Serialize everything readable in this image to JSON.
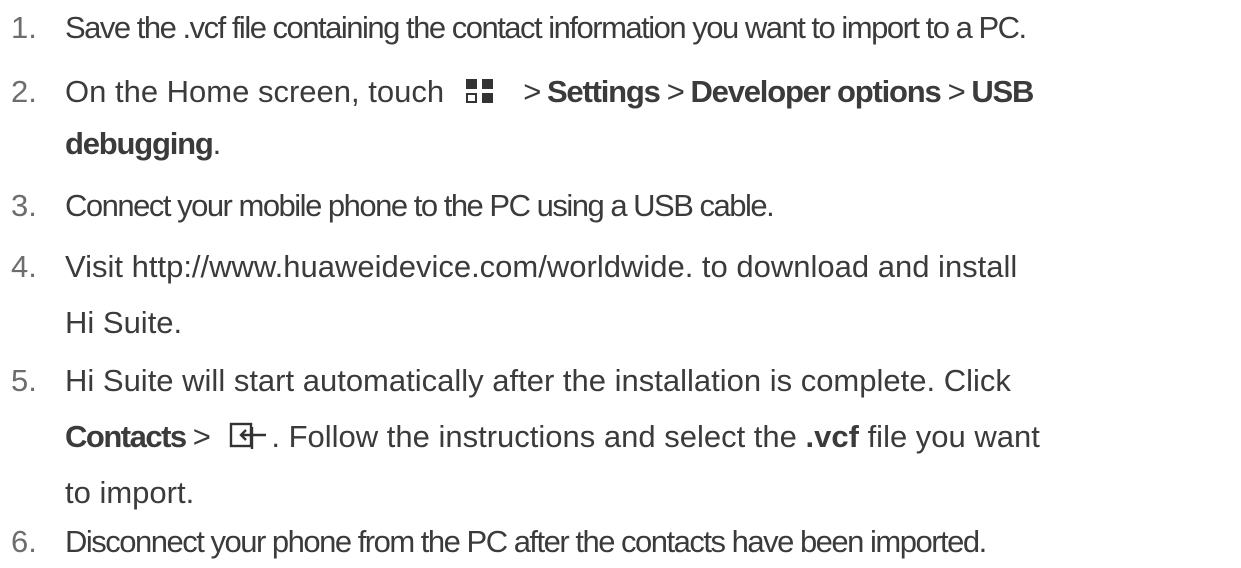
{
  "steps": [
    {
      "number": "1.",
      "text": "Save the .vcf file containing the contact information you want to import to a PC."
    },
    {
      "number": "2.",
      "prefix": "On the Home screen, touch",
      "sep1": " > ",
      "settings": "Settings",
      "sep2": " > ",
      "developer_options": "Developer options",
      "sep3": " > ",
      "usb": "USB",
      "debugging": "debugging",
      "period": ".",
      "icon": "apps-grid-icon"
    },
    {
      "number": "3.",
      "text": "Connect your mobile phone to the PC using a USB cable."
    },
    {
      "number": "4.",
      "line1": "Visit http://www.huaweidevice.com/worldwide. to download and install",
      "line2": "Hi Suite."
    },
    {
      "number": "5.",
      "line1": "Hi Suite will start automatically after the installation is complete. Click",
      "contacts": "Contacts",
      "sep": " >",
      "icon": "import-icon",
      "after_icon": ". Follow the instructions and select the ",
      "vcf": ".vcf",
      "after_vcf": " file you want",
      "line3": "to import."
    },
    {
      "number": "6.",
      "text": "Disconnect your phone from the PC after the contacts have been imported."
    }
  ],
  "colors": {
    "text": "#3b3b3b",
    "number": "#6d6d6d",
    "icon": "#333333"
  }
}
